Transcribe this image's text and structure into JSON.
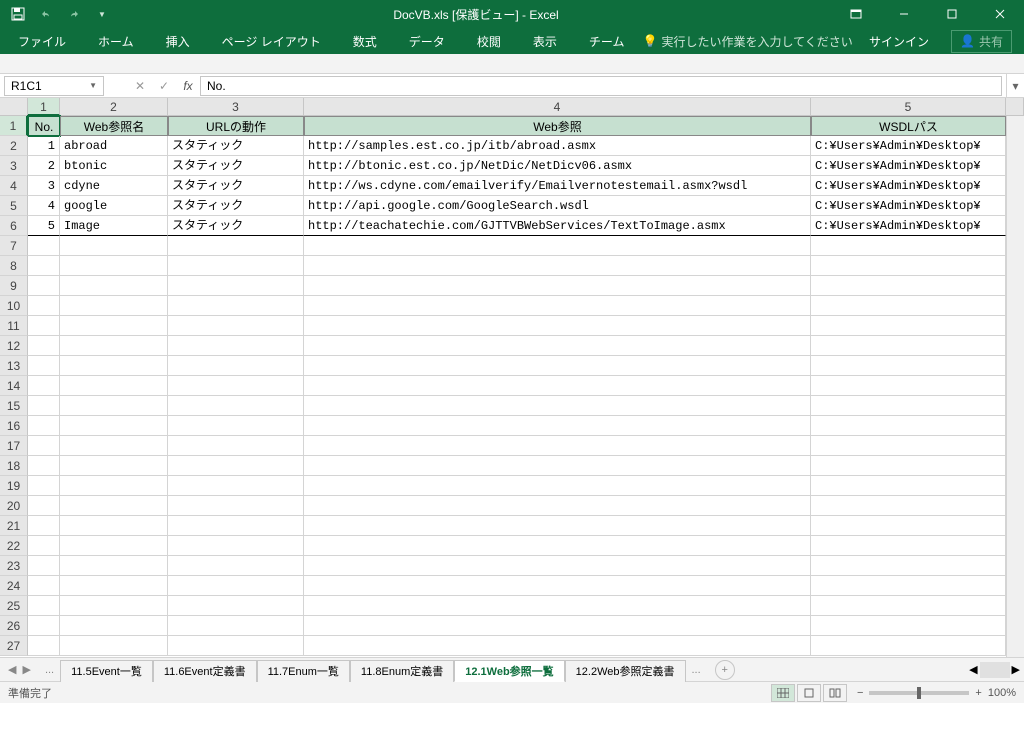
{
  "title": "DocVB.xls [保護ビュー] - Excel",
  "ribbon": {
    "file": "ファイル",
    "home": "ホーム",
    "insert": "挿入",
    "pagelayout": "ページ レイアウト",
    "formulas": "数式",
    "data": "データ",
    "review": "校閲",
    "view": "表示",
    "team": "チーム",
    "tellme": "実行したい作業を入力してください",
    "signin": "サインイン",
    "share": "共有"
  },
  "namebox": "R1C1",
  "formula": "No.",
  "columns": [
    "1",
    "2",
    "3",
    "4",
    "5"
  ],
  "row_headers": [
    "1",
    "2",
    "3",
    "4",
    "5",
    "6",
    "7",
    "8",
    "9",
    "10",
    "11",
    "12",
    "13",
    "14",
    "15",
    "16",
    "17",
    "18",
    "19",
    "20",
    "21",
    "22",
    "23",
    "24",
    "25",
    "26",
    "27"
  ],
  "table_headers": {
    "c1": "No.",
    "c2": "Web参照名",
    "c3": "URLの動作",
    "c4": "Web参照",
    "c5": "WSDLパス"
  },
  "rows": [
    {
      "no": "1",
      "name": "abroad",
      "url_behavior": "スタティック",
      "web_ref": "http://samples.est.co.jp/itb/abroad.asmx",
      "wsdl": "C:¥Users¥Admin¥Desktop¥"
    },
    {
      "no": "2",
      "name": "btonic",
      "url_behavior": "スタティック",
      "web_ref": "http://btonic.est.co.jp/NetDic/NetDicv06.asmx",
      "wsdl": "C:¥Users¥Admin¥Desktop¥"
    },
    {
      "no": "3",
      "name": "cdyne",
      "url_behavior": "スタティック",
      "web_ref": "http://ws.cdyne.com/emailverify/Emailvernotestemail.asmx?wsdl",
      "wsdl": "C:¥Users¥Admin¥Desktop¥"
    },
    {
      "no": "4",
      "name": "google",
      "url_behavior": "スタティック",
      "web_ref": "http://api.google.com/GoogleSearch.wsdl",
      "wsdl": "C:¥Users¥Admin¥Desktop¥"
    },
    {
      "no": "5",
      "name": "Image",
      "url_behavior": "スタティック",
      "web_ref": "http://teachatechie.com/GJTTVBWebServices/TextToImage.asmx",
      "wsdl": "C:¥Users¥Admin¥Desktop¥"
    }
  ],
  "sheet_tabs": {
    "t1": "11.5Event一覧",
    "t2": "11.6Event定義書",
    "t3": "11.7Enum一覧",
    "t4": "11.8Enum定義書",
    "t5": "12.1Web参照一覧",
    "t6": "12.2Web参照定義書"
  },
  "status": "準備完了",
  "zoom": "100%"
}
